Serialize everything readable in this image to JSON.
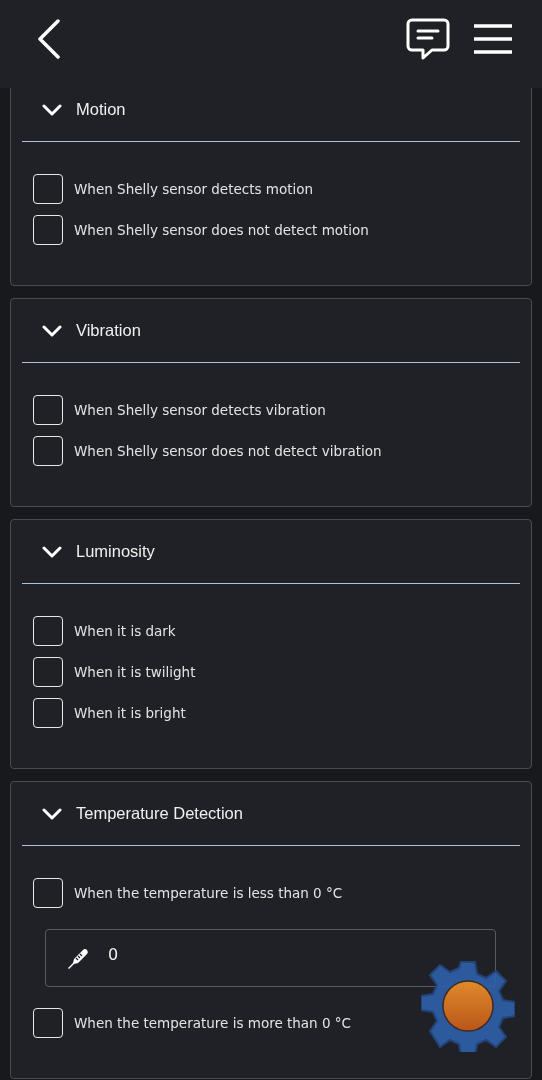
{
  "sections": [
    {
      "title": "Motion",
      "expanded": true,
      "items": [
        {
          "kind": "checkbox",
          "label": "When Shelly sensor detects motion",
          "checked": false
        },
        {
          "kind": "checkbox",
          "label": "When Shelly sensor does not detect motion",
          "checked": false
        }
      ]
    },
    {
      "title": "Vibration",
      "expanded": true,
      "items": [
        {
          "kind": "checkbox",
          "label": "When Shelly sensor detects vibration",
          "checked": false
        },
        {
          "kind": "checkbox",
          "label": "When Shelly sensor does not detect vibration",
          "checked": false
        }
      ]
    },
    {
      "title": "Luminosity",
      "expanded": true,
      "items": [
        {
          "kind": "checkbox",
          "label": "When it is dark",
          "checked": false
        },
        {
          "kind": "checkbox",
          "label": "When it is twilight",
          "checked": false
        },
        {
          "kind": "checkbox",
          "label": "When it is bright",
          "checked": false
        }
      ]
    },
    {
      "title": "Temperature Detection",
      "expanded": true,
      "items": [
        {
          "kind": "checkbox",
          "label": "When the temperature is less than 0 °C",
          "checked": false
        },
        {
          "kind": "input",
          "value": "0"
        },
        {
          "kind": "checkbox",
          "label": "When the temperature is more than 0 °C",
          "checked": false
        }
      ]
    }
  ]
}
